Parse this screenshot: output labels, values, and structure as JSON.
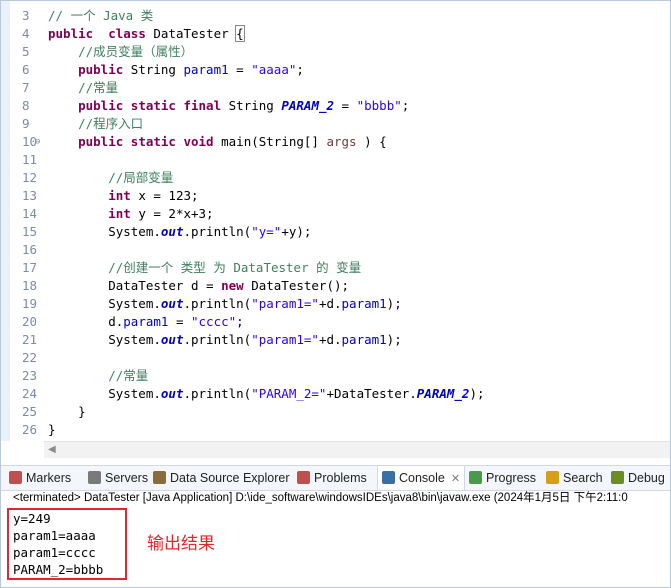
{
  "editor": {
    "lines": [
      {
        "n": "3",
        "tokens": [
          [
            "cm",
            "// 一个 Java 类"
          ]
        ]
      },
      {
        "n": "4",
        "tokens": [
          [
            "kw",
            "public"
          ],
          [
            "",
            "  "
          ],
          [
            "kw",
            "class"
          ],
          [
            "",
            " DataTester "
          ],
          [
            "br",
            "{"
          ]
        ]
      },
      {
        "n": "5",
        "tokens": [
          [
            "",
            "    "
          ],
          [
            "cm",
            "//成员变量（属性）"
          ]
        ]
      },
      {
        "n": "6",
        "tokens": [
          [
            "",
            "    "
          ],
          [
            "kw",
            "public"
          ],
          [
            "",
            " String "
          ],
          [
            "fd",
            "param1"
          ],
          [
            "",
            " = "
          ],
          [
            "st",
            "\"aaaa\""
          ],
          [
            "",
            ";"
          ]
        ]
      },
      {
        "n": "7",
        "tokens": [
          [
            "",
            "    "
          ],
          [
            "cm",
            "//常量"
          ]
        ]
      },
      {
        "n": "8",
        "tokens": [
          [
            "",
            "    "
          ],
          [
            "kw",
            "public"
          ],
          [
            "",
            " "
          ],
          [
            "kw",
            "static"
          ],
          [
            "",
            " "
          ],
          [
            "kw",
            "final"
          ],
          [
            "",
            " String "
          ],
          [
            "sf",
            "PARAM_2"
          ],
          [
            "",
            " = "
          ],
          [
            "st",
            "\"bbbb\""
          ],
          [
            "",
            ";"
          ]
        ]
      },
      {
        "n": "9",
        "tokens": [
          [
            "",
            "    "
          ],
          [
            "cm",
            "//程序入口"
          ]
        ]
      },
      {
        "n": "10",
        "fold": true,
        "tokens": [
          [
            "",
            "    "
          ],
          [
            "kw",
            "public"
          ],
          [
            "",
            " "
          ],
          [
            "kw",
            "static"
          ],
          [
            "",
            " "
          ],
          [
            "kw",
            "void"
          ],
          [
            "",
            " main(String[] "
          ],
          [
            "va",
            "args"
          ],
          [
            "",
            " ) {"
          ]
        ]
      },
      {
        "n": "11",
        "tokens": []
      },
      {
        "n": "12",
        "tokens": [
          [
            "",
            "        "
          ],
          [
            "cm",
            "//局部变量"
          ]
        ]
      },
      {
        "n": "13",
        "tokens": [
          [
            "",
            "        "
          ],
          [
            "kw",
            "int"
          ],
          [
            "",
            " x = 123;"
          ]
        ]
      },
      {
        "n": "14",
        "tokens": [
          [
            "",
            "        "
          ],
          [
            "kw",
            "int"
          ],
          [
            "",
            " y = 2*x+3;"
          ]
        ]
      },
      {
        "n": "15",
        "tokens": [
          [
            "",
            "        System."
          ],
          [
            "sf",
            "out"
          ],
          [
            "",
            ".println("
          ],
          [
            "st",
            "\"y=\""
          ],
          [
            "",
            "+y);"
          ]
        ]
      },
      {
        "n": "16",
        "tokens": []
      },
      {
        "n": "17",
        "tokens": [
          [
            "",
            "        "
          ],
          [
            "cm",
            "//创建一个 类型 为 DataTester 的 变量"
          ]
        ]
      },
      {
        "n": "18",
        "tokens": [
          [
            "",
            "        DataTester d = "
          ],
          [
            "kw",
            "new"
          ],
          [
            "",
            " DataTester();"
          ]
        ]
      },
      {
        "n": "19",
        "tokens": [
          [
            "",
            "        System."
          ],
          [
            "sf",
            "out"
          ],
          [
            "",
            ".println("
          ],
          [
            "st",
            "\"param1=\""
          ],
          [
            "",
            "+d."
          ],
          [
            "fd",
            "param1"
          ],
          [
            "",
            ");"
          ]
        ]
      },
      {
        "n": "20",
        "tokens": [
          [
            "",
            "        d."
          ],
          [
            "fd",
            "param1"
          ],
          [
            "",
            " = "
          ],
          [
            "st",
            "\"cccc\""
          ],
          [
            "",
            ";"
          ]
        ]
      },
      {
        "n": "21",
        "tokens": [
          [
            "",
            "        System."
          ],
          [
            "sf",
            "out"
          ],
          [
            "",
            ".println("
          ],
          [
            "st",
            "\"param1=\""
          ],
          [
            "",
            "+d."
          ],
          [
            "fd",
            "param1"
          ],
          [
            "",
            ");"
          ]
        ]
      },
      {
        "n": "22",
        "tokens": []
      },
      {
        "n": "23",
        "tokens": [
          [
            "",
            "        "
          ],
          [
            "cm",
            "//常量"
          ]
        ]
      },
      {
        "n": "24",
        "tokens": [
          [
            "",
            "        System."
          ],
          [
            "sf",
            "out"
          ],
          [
            "",
            ".println("
          ],
          [
            "st",
            "\"PARAM_2=\""
          ],
          [
            "",
            "+DataTester."
          ],
          [
            "sf",
            "PARAM_2"
          ],
          [
            "",
            ");"
          ]
        ]
      },
      {
        "n": "25",
        "tokens": [
          [
            "",
            "    }"
          ]
        ]
      },
      {
        "n": "26",
        "tokens": [
          [
            "",
            "}"
          ]
        ]
      }
    ]
  },
  "tabs": [
    {
      "label": "Markers",
      "icon": "markers-icon",
      "color": "#c0504d"
    },
    {
      "label": "Servers",
      "icon": "servers-icon",
      "color": "#7a7a7a"
    },
    {
      "label": "Data Source Explorer",
      "icon": "data-source-icon",
      "color": "#8a6d3b"
    },
    {
      "label": "Problems",
      "icon": "problems-icon",
      "color": "#c0504d"
    },
    {
      "label": "Console",
      "icon": "console-icon",
      "color": "#3b6ea5",
      "active": true,
      "close": "✕"
    },
    {
      "label": "Progress",
      "icon": "progress-icon",
      "color": "#4a9a4a"
    },
    {
      "label": "Search",
      "icon": "search-icon",
      "color": "#d4a017"
    },
    {
      "label": "Debug",
      "icon": "debug-icon",
      "color": "#6b8e23"
    }
  ],
  "console": {
    "status": "<terminated> DataTester [Java Application] D:\\ide_software\\windowsIDEs\\java8\\bin\\javaw.exe (2024年1月5日 下午2:11:0",
    "output": [
      "y=249",
      "param1=aaaa",
      "param1=cccc",
      "PARAM_2=bbbb"
    ],
    "annotation": "输出结果"
  },
  "colors": {
    "highlight_box": "#e8242d",
    "keyword": "#7f0055",
    "comment": "#3f7f5f",
    "string": "#2a00ff"
  }
}
